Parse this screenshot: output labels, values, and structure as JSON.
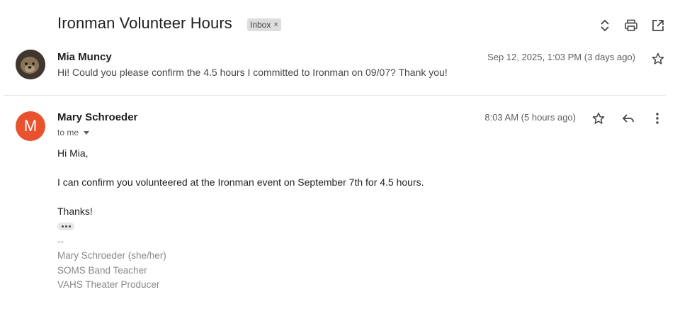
{
  "thread": {
    "subject": "Ironman Volunteer Hours",
    "label": "Inbox",
    "label_remove": "×",
    "icons": [
      "expand-collapse-icon",
      "print-icon",
      "open-in-new-window-icon"
    ]
  },
  "messages": [
    {
      "sender": "Mia Muncy",
      "snippet": "Hi! Could you please confirm the 4.5 hours I committed to Ironman on 09/07? Thank you!",
      "date": "Sep 12, 2025, 1:03 PM (3 days ago)",
      "avatar": "photo"
    },
    {
      "sender": "Mary Schroeder",
      "avatar_letter": "M",
      "avatar_color": "#e8522f",
      "to": "to me",
      "date": "8:03 AM (5 hours ago)",
      "body": {
        "greeting": "Hi Mia,",
        "line1": "I can confirm you volunteered at the Ironman event on September 7th for 4.5 hours.",
        "closing": "Thanks!"
      },
      "signature": {
        "dash": "--",
        "name": "Mary Schroeder (she/her)",
        "title1": "SOMS Band Teacher",
        "title2": "VAHS Theater Producer"
      }
    }
  ]
}
